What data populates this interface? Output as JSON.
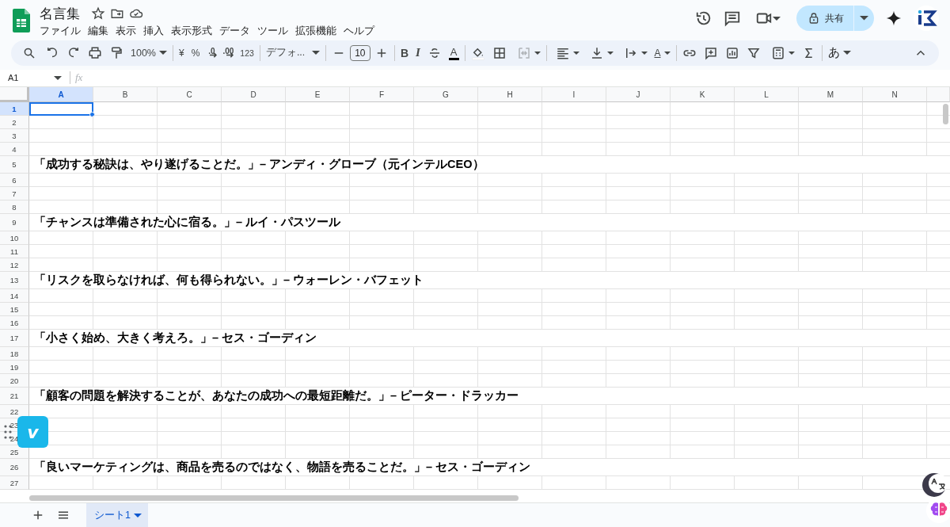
{
  "title": "名言集",
  "menus": [
    "ファイル",
    "編集",
    "表示",
    "挿入",
    "表示形式",
    "データ",
    "ツール",
    "拡張機能",
    "ヘルプ"
  ],
  "share": {
    "label": "共有"
  },
  "toolbar": {
    "zoom": "100%",
    "currency": "¥",
    "percent": "%",
    "decimal_decrease": ".0",
    "decimal_increase": ".00",
    "number_format": "123",
    "font": "デフォ...",
    "font_size": "10",
    "bold": "B",
    "italic": "I",
    "text_color": "A",
    "text_rotation": "A",
    "input_tool": "あ"
  },
  "name_box": "A1",
  "formula_label": "fx",
  "columns": [
    {
      "label": "A",
      "selected": true
    },
    {
      "label": "B",
      "selected": false
    },
    {
      "label": "C",
      "selected": false
    },
    {
      "label": "D",
      "selected": false
    },
    {
      "label": "E",
      "selected": false
    },
    {
      "label": "F",
      "selected": false
    },
    {
      "label": "G",
      "selected": false
    },
    {
      "label": "H",
      "selected": false
    },
    {
      "label": "I",
      "selected": false
    },
    {
      "label": "J",
      "selected": false
    },
    {
      "label": "K",
      "selected": false
    },
    {
      "label": "L",
      "selected": false
    },
    {
      "label": "M",
      "selected": false
    },
    {
      "label": "N",
      "selected": false
    }
  ],
  "rows": [
    {
      "number": "1",
      "selected": true
    },
    {
      "number": "2",
      "selected": false
    },
    {
      "number": "3",
      "selected": false
    },
    {
      "number": "4",
      "selected": false
    },
    {
      "number": "5",
      "selected": false,
      "text": "「成功する秘訣は、やり遂げることだ。」– アンディ・グローブ（元インテルCEO）"
    },
    {
      "number": "6",
      "selected": false
    },
    {
      "number": "7",
      "selected": false
    },
    {
      "number": "8",
      "selected": false
    },
    {
      "number": "9",
      "selected": false,
      "text": "「チャンスは準備された心に宿る。」– ルイ・パスツール"
    },
    {
      "number": "10",
      "selected": false
    },
    {
      "number": "11",
      "selected": false
    },
    {
      "number": "12",
      "selected": false
    },
    {
      "number": "13",
      "selected": false,
      "text": "「リスクを取らなければ、何も得られない。」– ウォーレン・バフェット"
    },
    {
      "number": "14",
      "selected": false
    },
    {
      "number": "15",
      "selected": false
    },
    {
      "number": "16",
      "selected": false
    },
    {
      "number": "17",
      "selected": false,
      "text": "「小さく始め、大きく考えろ。」– セス・ゴーディン"
    },
    {
      "number": "18",
      "selected": false
    },
    {
      "number": "19",
      "selected": false
    },
    {
      "number": "20",
      "selected": false
    },
    {
      "number": "21",
      "selected": false,
      "text": "「顧客の問題を解決することが、あなたの成功への最短距離だ。」– ピーター・ドラッカー"
    },
    {
      "number": "22",
      "selected": false
    },
    {
      "number": "23",
      "selected": false
    },
    {
      "number": "24",
      "selected": false
    },
    {
      "number": "25",
      "selected": false
    },
    {
      "number": "26",
      "selected": false,
      "text": "「良いマーケティングは、商品を売るのではなく、物語を売ることだ。」– セス・ゴーディン"
    },
    {
      "number": "27",
      "selected": false
    }
  ],
  "sheet_tabs": [
    {
      "label": "シート1",
      "selected": true
    }
  ],
  "floating_button": {
    "label": "v"
  }
}
